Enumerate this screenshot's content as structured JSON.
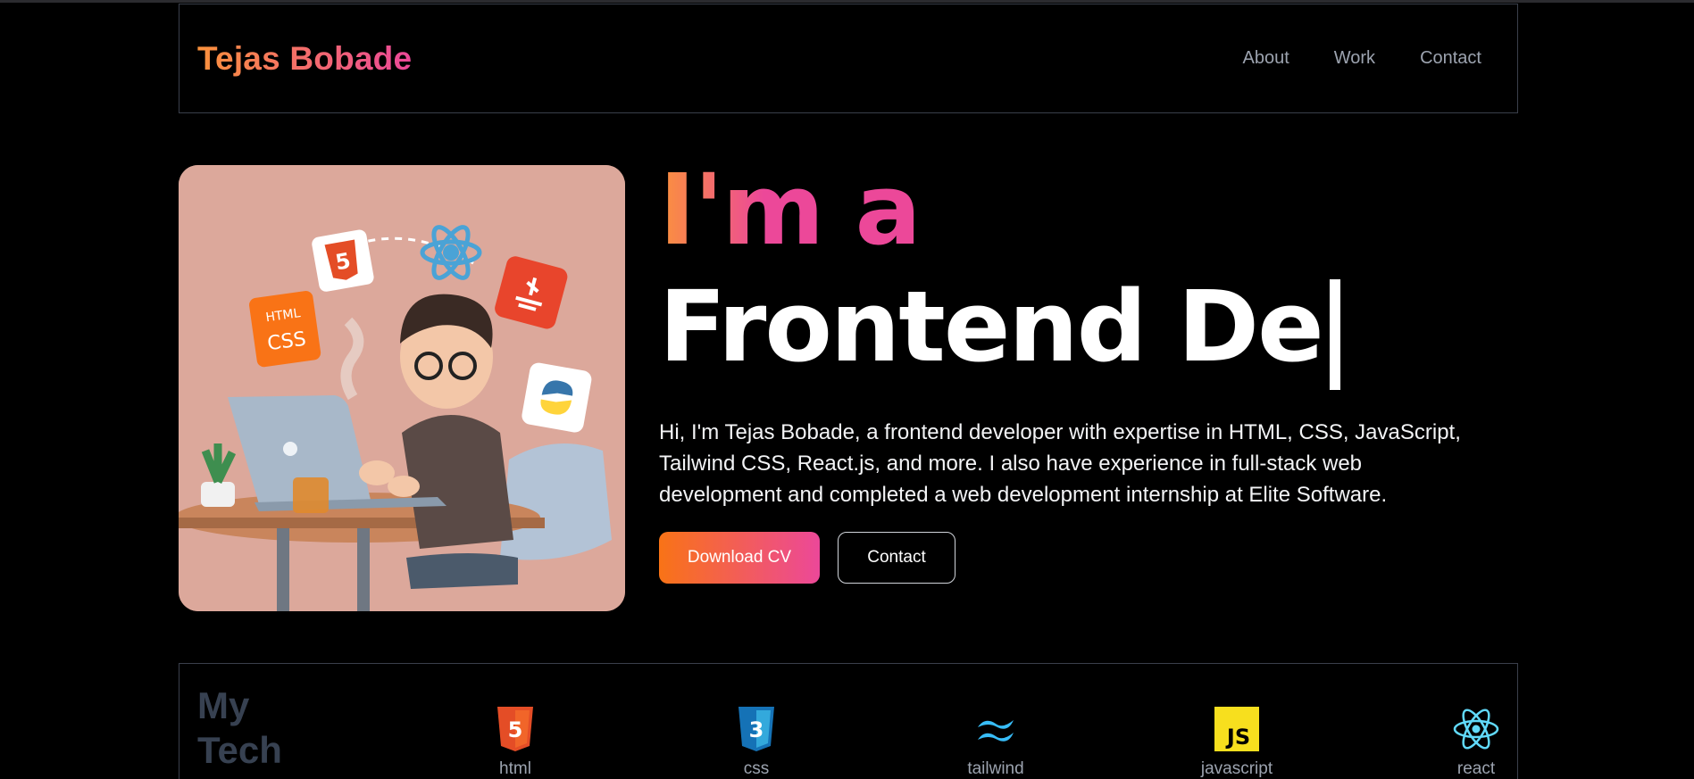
{
  "header": {
    "brand": "Tejas Bobade",
    "nav": [
      "About",
      "Work",
      "Contact"
    ]
  },
  "hero": {
    "line1": "I'm a",
    "line2": "Frontend De",
    "bio": "Hi, I'm Tejas Bobade, a frontend developer with expertise in HTML, CSS, JavaScript, Tailwind CSS, React.js, and more. I also have experience in full-stack web development and completed a web development internship at Elite Software.",
    "download_label": "Download CV",
    "contact_label": "Contact",
    "illustration_badge": {
      "top": "HTML",
      "bottom": "CSS"
    }
  },
  "stack": {
    "title": "My Tech Stack",
    "items": [
      {
        "label": "html",
        "icon": "html5-icon"
      },
      {
        "label": "css",
        "icon": "css3-icon"
      },
      {
        "label": "tailwind",
        "icon": "tailwind-icon"
      },
      {
        "label": "javascript",
        "icon": "javascript-icon"
      },
      {
        "label": "react",
        "icon": "react-icon"
      }
    ]
  },
  "colors": {
    "accent_start": "#fb923c",
    "accent_end": "#ec4899",
    "background": "#000000",
    "muted": "#9ca3af"
  }
}
